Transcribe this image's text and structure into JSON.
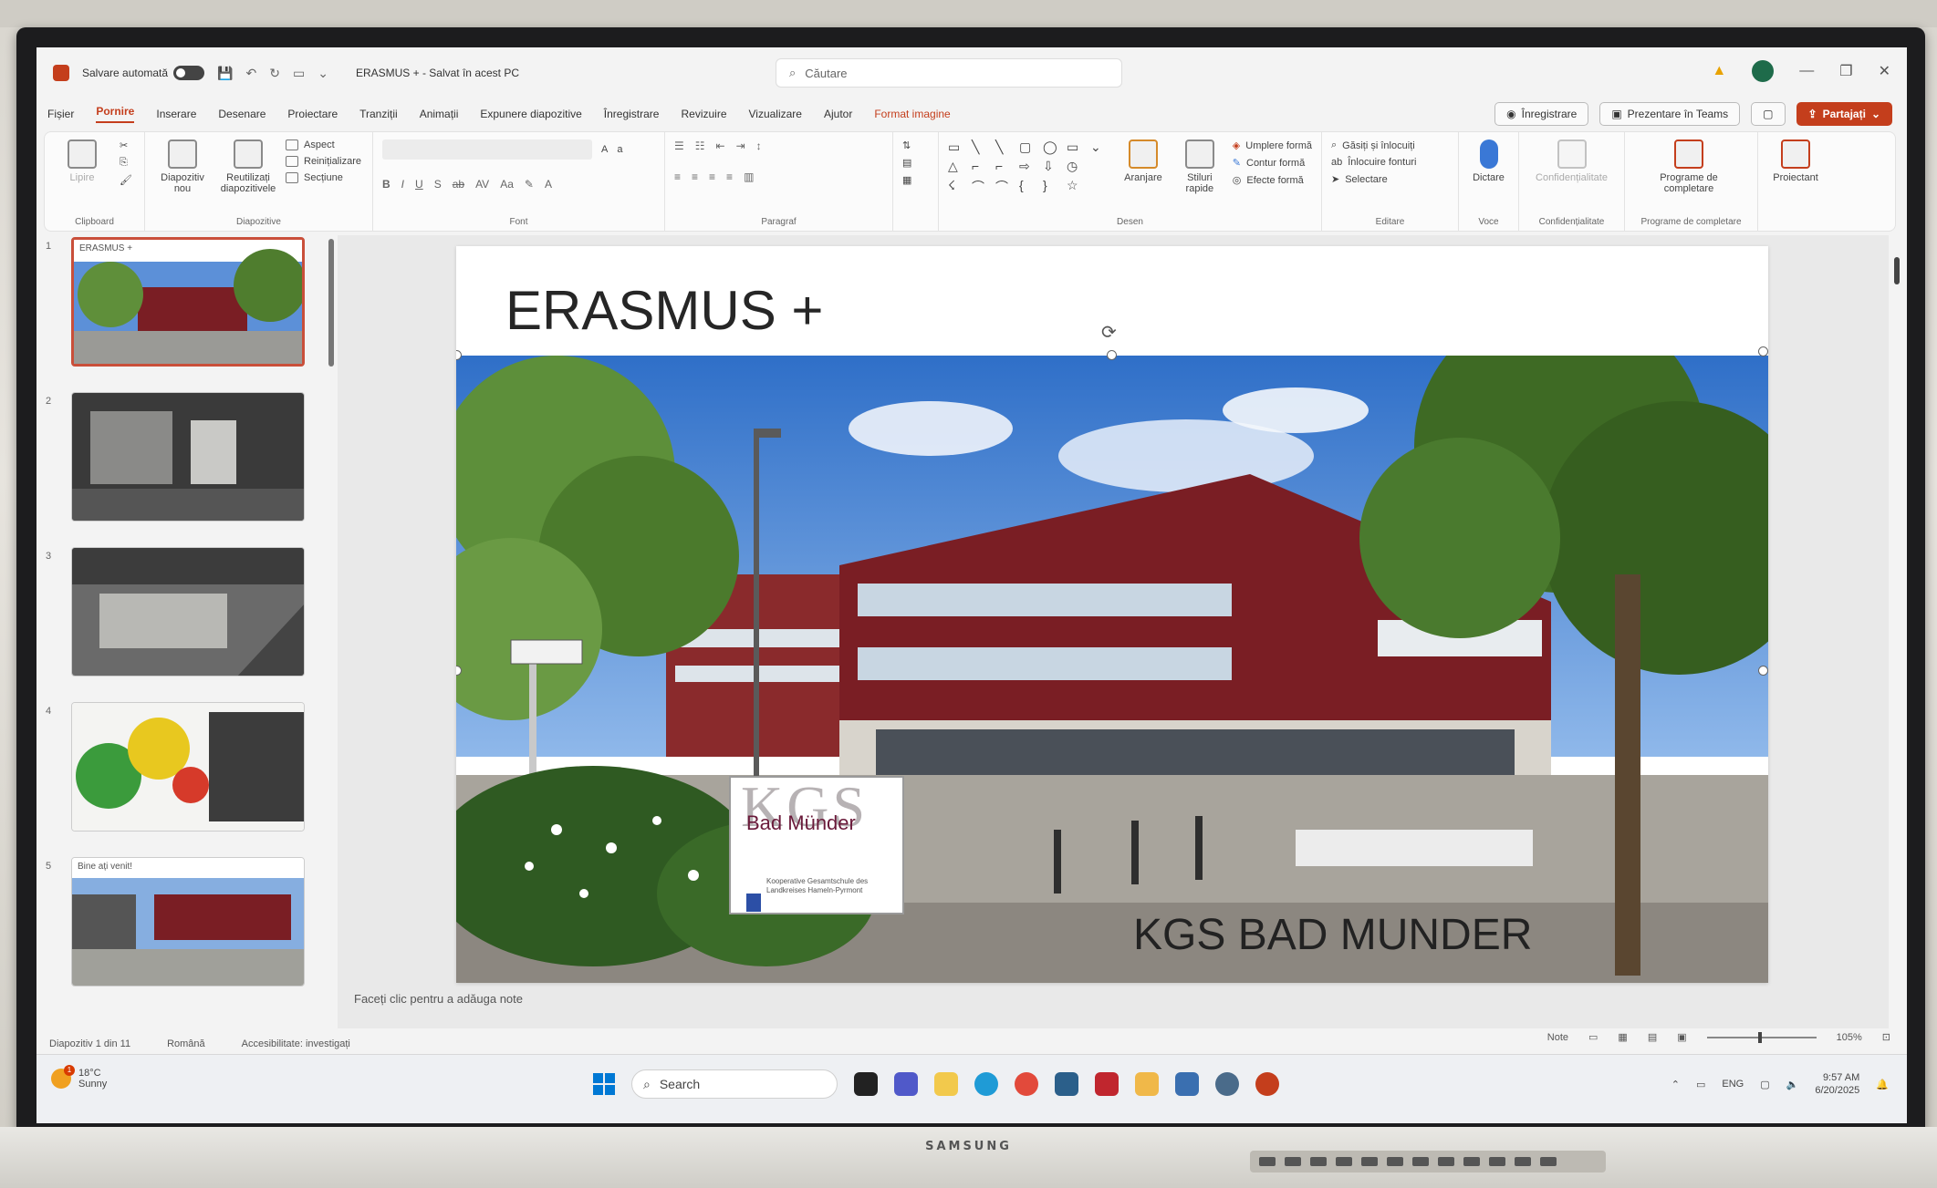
{
  "device": {
    "brand": "SAMSUNG"
  },
  "titlebar": {
    "autosave_label": "Salvare automată",
    "doc_title": "ERASMUS + - Salvat în acest PC",
    "search_placeholder": "Căutare"
  },
  "tabs": [
    {
      "label": "Fișier"
    },
    {
      "label": "Pornire"
    },
    {
      "label": "Inserare"
    },
    {
      "label": "Desenare"
    },
    {
      "label": "Proiectare"
    },
    {
      "label": "Tranziții"
    },
    {
      "label": "Animații"
    },
    {
      "label": "Expunere diapozitive"
    },
    {
      "label": "Înregistrare"
    },
    {
      "label": "Revizuire"
    },
    {
      "label": "Vizualizare"
    },
    {
      "label": "Ajutor"
    },
    {
      "label": "Format imagine"
    }
  ],
  "actions": {
    "record": "Înregistrare",
    "present_teams": "Prezentare în Teams",
    "share": "Partajați"
  },
  "ribbon": {
    "clipboard_label": "Clipboard",
    "paste": "Lipire",
    "new_slide": "Diapozitiv nou",
    "reuse_slides": "Reutilizați diapozitivele",
    "layout": "Aspect",
    "reset": "Reinițializare",
    "section": "Secțiune",
    "slides_group": "Diapozitive",
    "font_group": "Font",
    "paragraph_group": "Paragraf",
    "arrange": "Aranjare",
    "quick_styles": "Stiluri rapide",
    "shape_fill": "Umplere formă",
    "shape_outline": "Contur formă",
    "shape_effects": "Efecte formă",
    "drawing_group": "Desen",
    "find": "Găsiți și înlocuiți",
    "replace_fonts": "Înlocuire fonturi",
    "select": "Selectare",
    "editing_group": "Editare",
    "dictate": "Dictare",
    "voice_group": "Voce",
    "sensitivity": "Confidențialitate",
    "sensitivity_group": "Confidențialitate",
    "addins": "Programe de completare",
    "addins_group": "Programe de completare",
    "designer": "Proiectant"
  },
  "thumbnails": [
    {
      "num": "1",
      "caption": "ERASMUS +"
    },
    {
      "num": "2",
      "caption": ""
    },
    {
      "num": "3",
      "caption": ""
    },
    {
      "num": "4",
      "caption": ""
    },
    {
      "num": "5",
      "caption": "Bine ați venit!"
    }
  ],
  "slide": {
    "title": "ERASMUS +",
    "sign_line1": "KGS",
    "sign_line2": "Bad Münder",
    "sign_small": "Kooperative Gesamtschule des Landkreises Hameln-Pyrmont",
    "caption": "KGS BAD MUNDER"
  },
  "notes_placeholder": "Faceți clic pentru a adăuga note",
  "statusbar": {
    "slide_count": "Diapozitiv 1 din 11",
    "language": "Română",
    "accessibility": "Accesibilitate: investigați",
    "notes": "Note",
    "zoom": "105%"
  },
  "taskbar": {
    "weather_temp": "18°C",
    "weather_desc": "Sunny",
    "search": "Search",
    "lang": "ENG",
    "time": "9:57 AM",
    "date": "6/20/2025"
  },
  "colors": {
    "accent": "#c43e1c",
    "building": "#7a1e24",
    "sky": "#3f7fd0"
  }
}
